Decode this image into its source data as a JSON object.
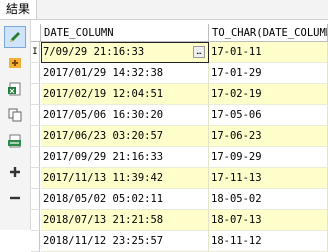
{
  "tab": {
    "label": "結果"
  },
  "toolbar": {
    "icons": [
      "edit-pencil-icon",
      "insert-record-icon",
      "export-excel-icon",
      "copy-icon",
      "export-csv-icon",
      "add-icon",
      "remove-icon"
    ]
  },
  "grid": {
    "columns": [
      "DATE_COLUMN",
      "TO_CHAR(DATE_COLUMN)"
    ],
    "current_row_marker": "I",
    "ellipsis_label": "…",
    "rows": [
      {
        "date": "7/09/29 21:16:33",
        "to_char": "17-01-11"
      },
      {
        "date": "2017/01/29 14:32:38",
        "to_char": "17-01-29"
      },
      {
        "date": "2017/02/19 12:04:51",
        "to_char": "17-02-19"
      },
      {
        "date": "2017/05/06 16:30:20",
        "to_char": "17-05-06"
      },
      {
        "date": "2017/06/23 03:20:57",
        "to_char": "17-06-23"
      },
      {
        "date": "2017/09/29 21:16:33",
        "to_char": "17-09-29"
      },
      {
        "date": "2017/11/13 11:39:42",
        "to_char": "17-11-13"
      },
      {
        "date": "2018/05/02 05:02:11",
        "to_char": "18-05-02"
      },
      {
        "date": "2018/07/13 21:21:58",
        "to_char": "18-07-13"
      },
      {
        "date": "2018/11/12 23:25:57",
        "to_char": "18-11-12"
      }
    ]
  },
  "colors": {
    "alt_row": "#ffffcc",
    "selection": "#cfe3fb"
  }
}
